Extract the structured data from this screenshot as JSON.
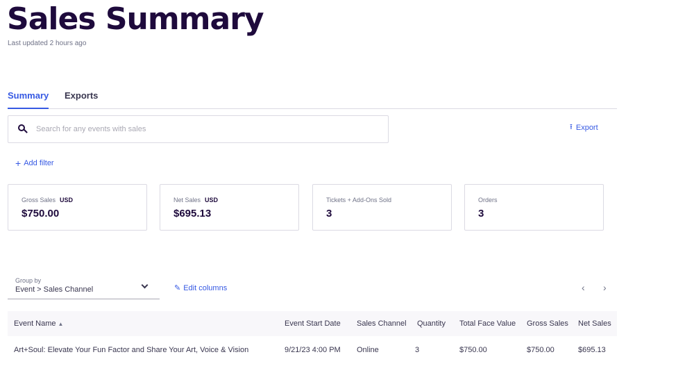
{
  "header": {
    "title": "Sales Summary",
    "updated": "Last updated 2 hours ago"
  },
  "tabs": [
    {
      "label": "Summary",
      "active": true
    },
    {
      "label": "Exports",
      "active": false
    }
  ],
  "search": {
    "placeholder": "Search for any events with sales",
    "value": ""
  },
  "actions": {
    "export": "Export",
    "add_filter": "Add filter",
    "edit_columns": "Edit columns"
  },
  "cards": [
    {
      "label": "Gross Sales",
      "currency": "USD",
      "value": "$750.00"
    },
    {
      "label": "Net Sales",
      "currency": "USD",
      "value": "$695.13"
    },
    {
      "label": "Tickets + Add-Ons Sold",
      "currency": "",
      "value": "3"
    },
    {
      "label": "Orders",
      "currency": "",
      "value": "3"
    }
  ],
  "group_by": {
    "label": "Group by",
    "value": "Event > Sales Channel"
  },
  "table": {
    "columns": [
      "Event Name",
      "Event Start Date",
      "Sales Channel",
      "Quantity",
      "Total Face Value",
      "Gross Sales",
      "Net Sales"
    ],
    "rows": [
      [
        "Art+Soul: Elevate Your Fun Factor and Share Your Art, Voice & Vision",
        "9/21/23 4:00 PM",
        "Online",
        "3",
        "$750.00",
        "$750.00",
        "$695.13"
      ]
    ]
  },
  "icons": {
    "search": "search-icon",
    "export": "upload-icon",
    "add_filter": "plus-icon",
    "edit_columns": "pencil-icon",
    "group_by": "chevron-down-icon",
    "sort": "sort-up-icon",
    "prev": "chevron-left-icon",
    "next": "chevron-right-icon"
  },
  "colors": {
    "title": "#1e0a3c",
    "accent": "#3659e3",
    "muted": "#6f7287",
    "border": "#dbdae3",
    "header_bg": "#f8f7fa"
  }
}
